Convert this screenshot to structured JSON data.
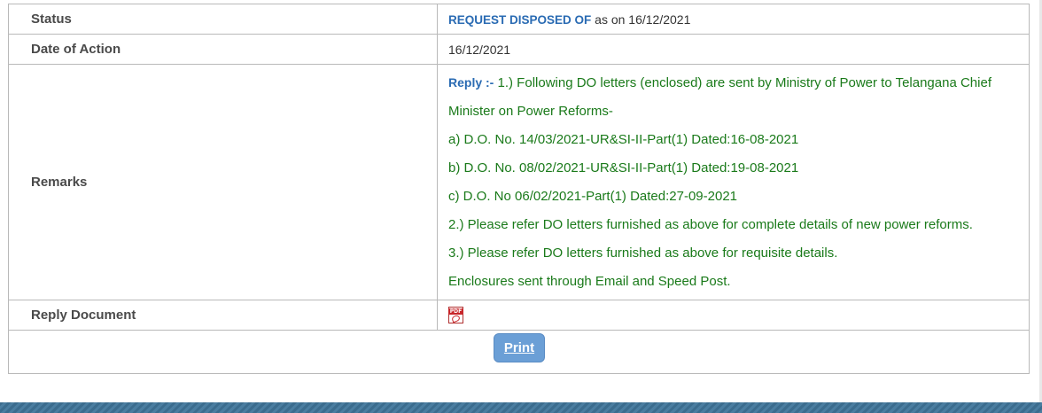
{
  "rows": {
    "status": {
      "label": "Status",
      "value_strong": "REQUEST DISPOSED OF",
      "value_rest": " as on 16/12/2021"
    },
    "date_of_action": {
      "label": "Date of Action",
      "value": "16/12/2021"
    },
    "remarks": {
      "label": "Remarks",
      "reply_prefix": "Reply :-",
      "lines": [
        " 1.) Following DO letters (enclosed) are sent by Ministry of Power to Telangana Chief",
        "Minister on Power Reforms-",
        "a) D.O. No. 14/03/2021-UR&SI-II-Part(1) Dated:16-08-2021",
        "b) D.O. No. 08/02/2021-UR&SI-II-Part(1) Dated:19-08-2021",
        "c) D.O. No 06/02/2021-Part(1) Dated:27-09-2021",
        "2.) Please refer DO letters furnished as above for complete details of new power reforms.",
        "3.) Please refer DO letters furnished as above for requisite details.",
        "Enclosures sent through Email and Speed Post."
      ]
    },
    "reply_document": {
      "label": "Reply Document",
      "icon": "pdf-icon",
      "icon_text": "PDF"
    }
  },
  "actions": {
    "print_label": "Print"
  },
  "colors": {
    "status_accent": "#2a6bb3",
    "remarks_text": "#1a7a1a",
    "button_bg": "#6b9fd6",
    "footer_band": "#3b6c8e"
  }
}
